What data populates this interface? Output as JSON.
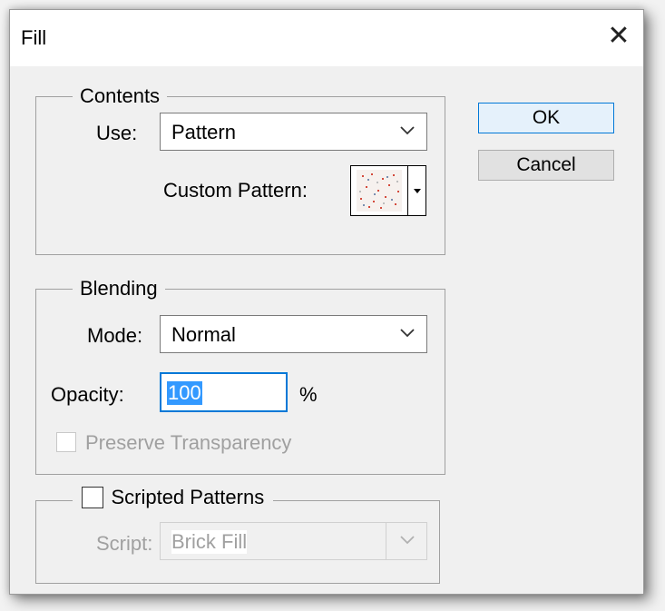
{
  "window": {
    "title": "Fill",
    "close_glyph": "✕"
  },
  "contents": {
    "legend": "Contents",
    "use_label": "Use:",
    "use_value": "Pattern",
    "custom_pattern_label": "Custom Pattern:"
  },
  "blending": {
    "legend": "Blending",
    "mode_label": "Mode:",
    "mode_value": "Normal",
    "opacity_label": "Opacity:",
    "opacity_value": "100",
    "opacity_unit": "%",
    "preserve_label": "Preserve Transparency",
    "preserve_checked": false,
    "preserve_enabled": false
  },
  "scripted": {
    "label": "Scripted Patterns",
    "checked": false,
    "script_label": "Script:",
    "script_value": "Brick Fill",
    "script_enabled": false
  },
  "buttons": {
    "ok": "OK",
    "cancel": "Cancel"
  },
  "colors": {
    "dialog_bg": "#f0f0f0",
    "accent": "#0078d7",
    "selection": "#3399ff",
    "disabled_text": "#a0a0a0"
  },
  "icons": {
    "close": "close-icon",
    "dropdown": "chevron-down-icon",
    "pattern_swatch": "pattern-swatch-icon",
    "pattern_picker_arrow": "caret-down-icon"
  }
}
